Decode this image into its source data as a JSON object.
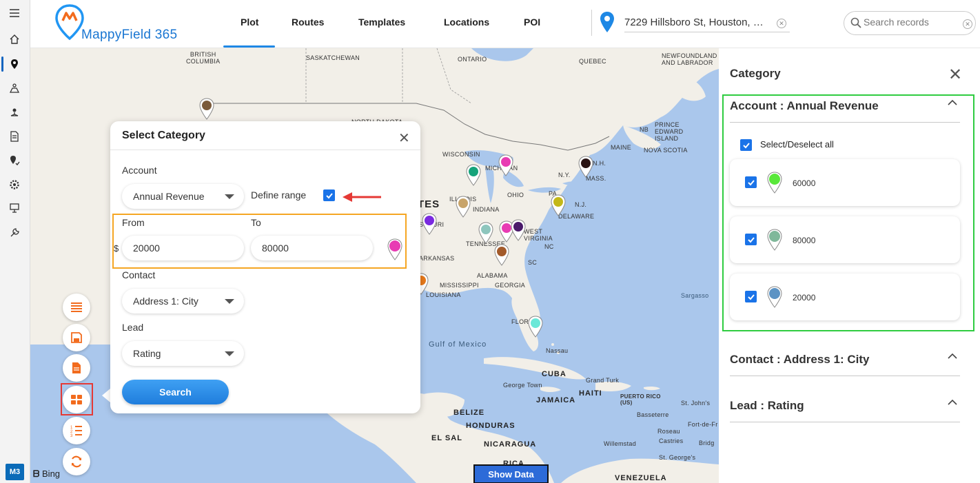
{
  "app": {
    "name": "MappyField 365",
    "avatar": "M3",
    "bing": "Bing"
  },
  "nav": {
    "tabs": [
      "Plot",
      "Routes",
      "Templates",
      "Locations",
      "POI"
    ],
    "active": "Plot"
  },
  "header": {
    "address": "7229 Hillsboro St, Houston, …",
    "search_placeholder": "Search records"
  },
  "rail": {
    "icons": [
      "menu-icon",
      "home-icon",
      "location-pin-icon",
      "map-route-icon",
      "network-icon",
      "document-icon",
      "pin-check-icon",
      "settings-icon",
      "presentation-icon",
      "tools-icon"
    ]
  },
  "map": {
    "show_data": "Show Data",
    "labels": {
      "british_columbia": "BRITISH\nCOLUMBIA",
      "saskatchewan": "SASKATCHEWAN",
      "ontario": "ONTARIO",
      "quebec": "QUEBEC",
      "newfoundland": "NEWFOUNDLAND\nAND LABRADOR",
      "north_dakota": "NORTH DAKOTA",
      "wisconsin": "WISCONSIN",
      "michigan": "MICHIGAN",
      "nb": "NB",
      "pei": "PRINCE\nEDWARD\nISLAND",
      "maine": "MAINE",
      "nova_scotia": "NOVA SCOTIA",
      "nh": "N.H.",
      "ny": "N.Y.",
      "mass": "MASS.",
      "ohio": "OHIO",
      "pa": "PA",
      "nj": "N.J.",
      "delaware": "DELAWARE",
      "illinois": "ILLINOIS",
      "indiana": "INDIANA",
      "west_virginia": "WEST\nVIRGINIA",
      "missouri": "SSOURI",
      "tennessee": "TENNESSEE",
      "nc": "NC",
      "sc": "SC",
      "arkansas": "ARKANSAS",
      "mississippi": "MISSISSIPPI",
      "alabama": "ALABAMA",
      "georgia": "GEORGIA",
      "louisiana": "LOUISIANA",
      "florida": "FLOR",
      "states": "TES",
      "gulf": "Gulf of Mexico",
      "nassau": "Nassau",
      "cuba": "CUBA",
      "george_town": "George Town",
      "jamaica": "JAMAICA",
      "haiti": "HAITI",
      "grand_turk": "Grand Turk",
      "puerto_rico": "PUERTO RICO\n(US)",
      "st_johns": "St. John's",
      "basseterre": "Basseterre",
      "fort_de_fr": "Fort-de-Fr",
      "roseau": "Roseau",
      "castries": "Castries",
      "bridg": "Bridg",
      "willemstad": "Willemstad",
      "st_georges": "St. George's",
      "belize": "BELIZE",
      "honduras": "HONDURAS",
      "el_sal": "EL SAL",
      "nicaragua": "NICARAGUA",
      "rica": "RICA",
      "venezuela": "VENEZUELA",
      "sargasso": "Sargasso"
    }
  },
  "popup": {
    "title": "Select Category",
    "account_label": "Account",
    "account_value": "Annual Revenue",
    "define_range": "Define range",
    "from_label": "From",
    "to_label": "To",
    "currency": "$",
    "from_value": "20000",
    "to_value": "80000",
    "contact_label": "Contact",
    "contact_value": "Address 1: City",
    "lead_label": "Lead",
    "lead_value": "Rating",
    "search": "Search",
    "pin_color": "#e83bb3"
  },
  "panel": {
    "title": "Category",
    "sections": [
      {
        "title": "Account : Annual Revenue",
        "select_all": "Select/Deselect all",
        "items": [
          {
            "value": "60000",
            "color": "#59e83a"
          },
          {
            "value": "80000",
            "color": "#7fb89a"
          },
          {
            "value": "20000",
            "color": "#5c93c4"
          }
        ]
      },
      {
        "title": "Contact : Address 1: City"
      },
      {
        "title": "Lead : Rating"
      }
    ]
  }
}
